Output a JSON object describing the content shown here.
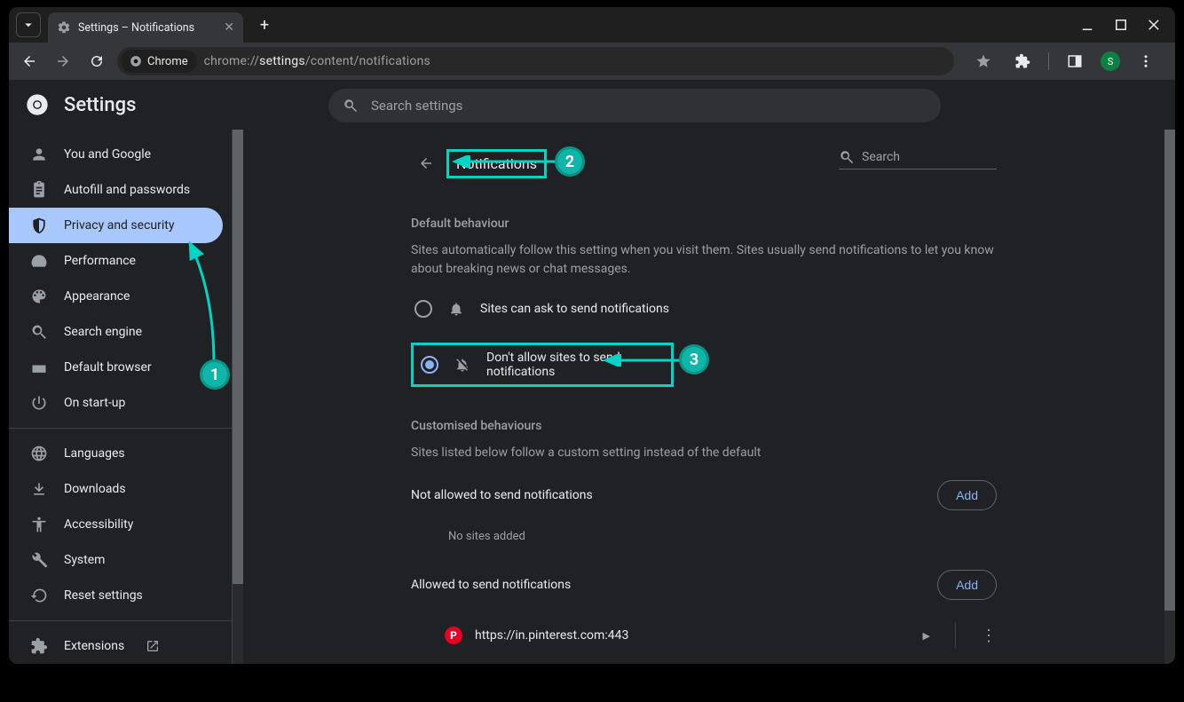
{
  "window": {
    "tab_title": "Settings – Notifications",
    "url_prefix": "chrome://",
    "url_mid": "settings",
    "url_suffix": "/content/notifications",
    "chip_label": "Chrome"
  },
  "header": {
    "app_title": "Settings",
    "search_placeholder": "Search settings"
  },
  "sidebar": {
    "items": [
      {
        "label": "You and Google"
      },
      {
        "label": "Autofill and passwords"
      },
      {
        "label": "Privacy and security"
      },
      {
        "label": "Performance"
      },
      {
        "label": "Appearance"
      },
      {
        "label": "Search engine"
      },
      {
        "label": "Default browser"
      },
      {
        "label": "On start-up"
      }
    ],
    "items2": [
      {
        "label": "Languages"
      },
      {
        "label": "Downloads"
      },
      {
        "label": "Accessibility"
      },
      {
        "label": "System"
      },
      {
        "label": "Reset settings"
      }
    ],
    "items3": [
      {
        "label": "Extensions"
      }
    ]
  },
  "page": {
    "title": "Notifications",
    "local_search_placeholder": "Search",
    "default_head": "Default behaviour",
    "default_desc": "Sites automatically follow this setting when you visit them. Sites usually send notifications to let you know about breaking news or chat messages.",
    "option_allow": "Sites can ask to send notifications",
    "option_block": "Don't allow sites to send notifications",
    "custom_head": "Customised behaviours",
    "custom_desc": "Sites listed below follow a custom setting instead of the default",
    "not_allowed_head": "Not allowed to send notifications",
    "no_sites": "No sites added",
    "allowed_head": "Allowed to send notifications",
    "add_label": "Add",
    "allowed_site": "https://in.pinterest.com:443"
  },
  "avatar_letter": "S",
  "annotations": {
    "a1": "1",
    "a2": "2",
    "a3": "3"
  }
}
